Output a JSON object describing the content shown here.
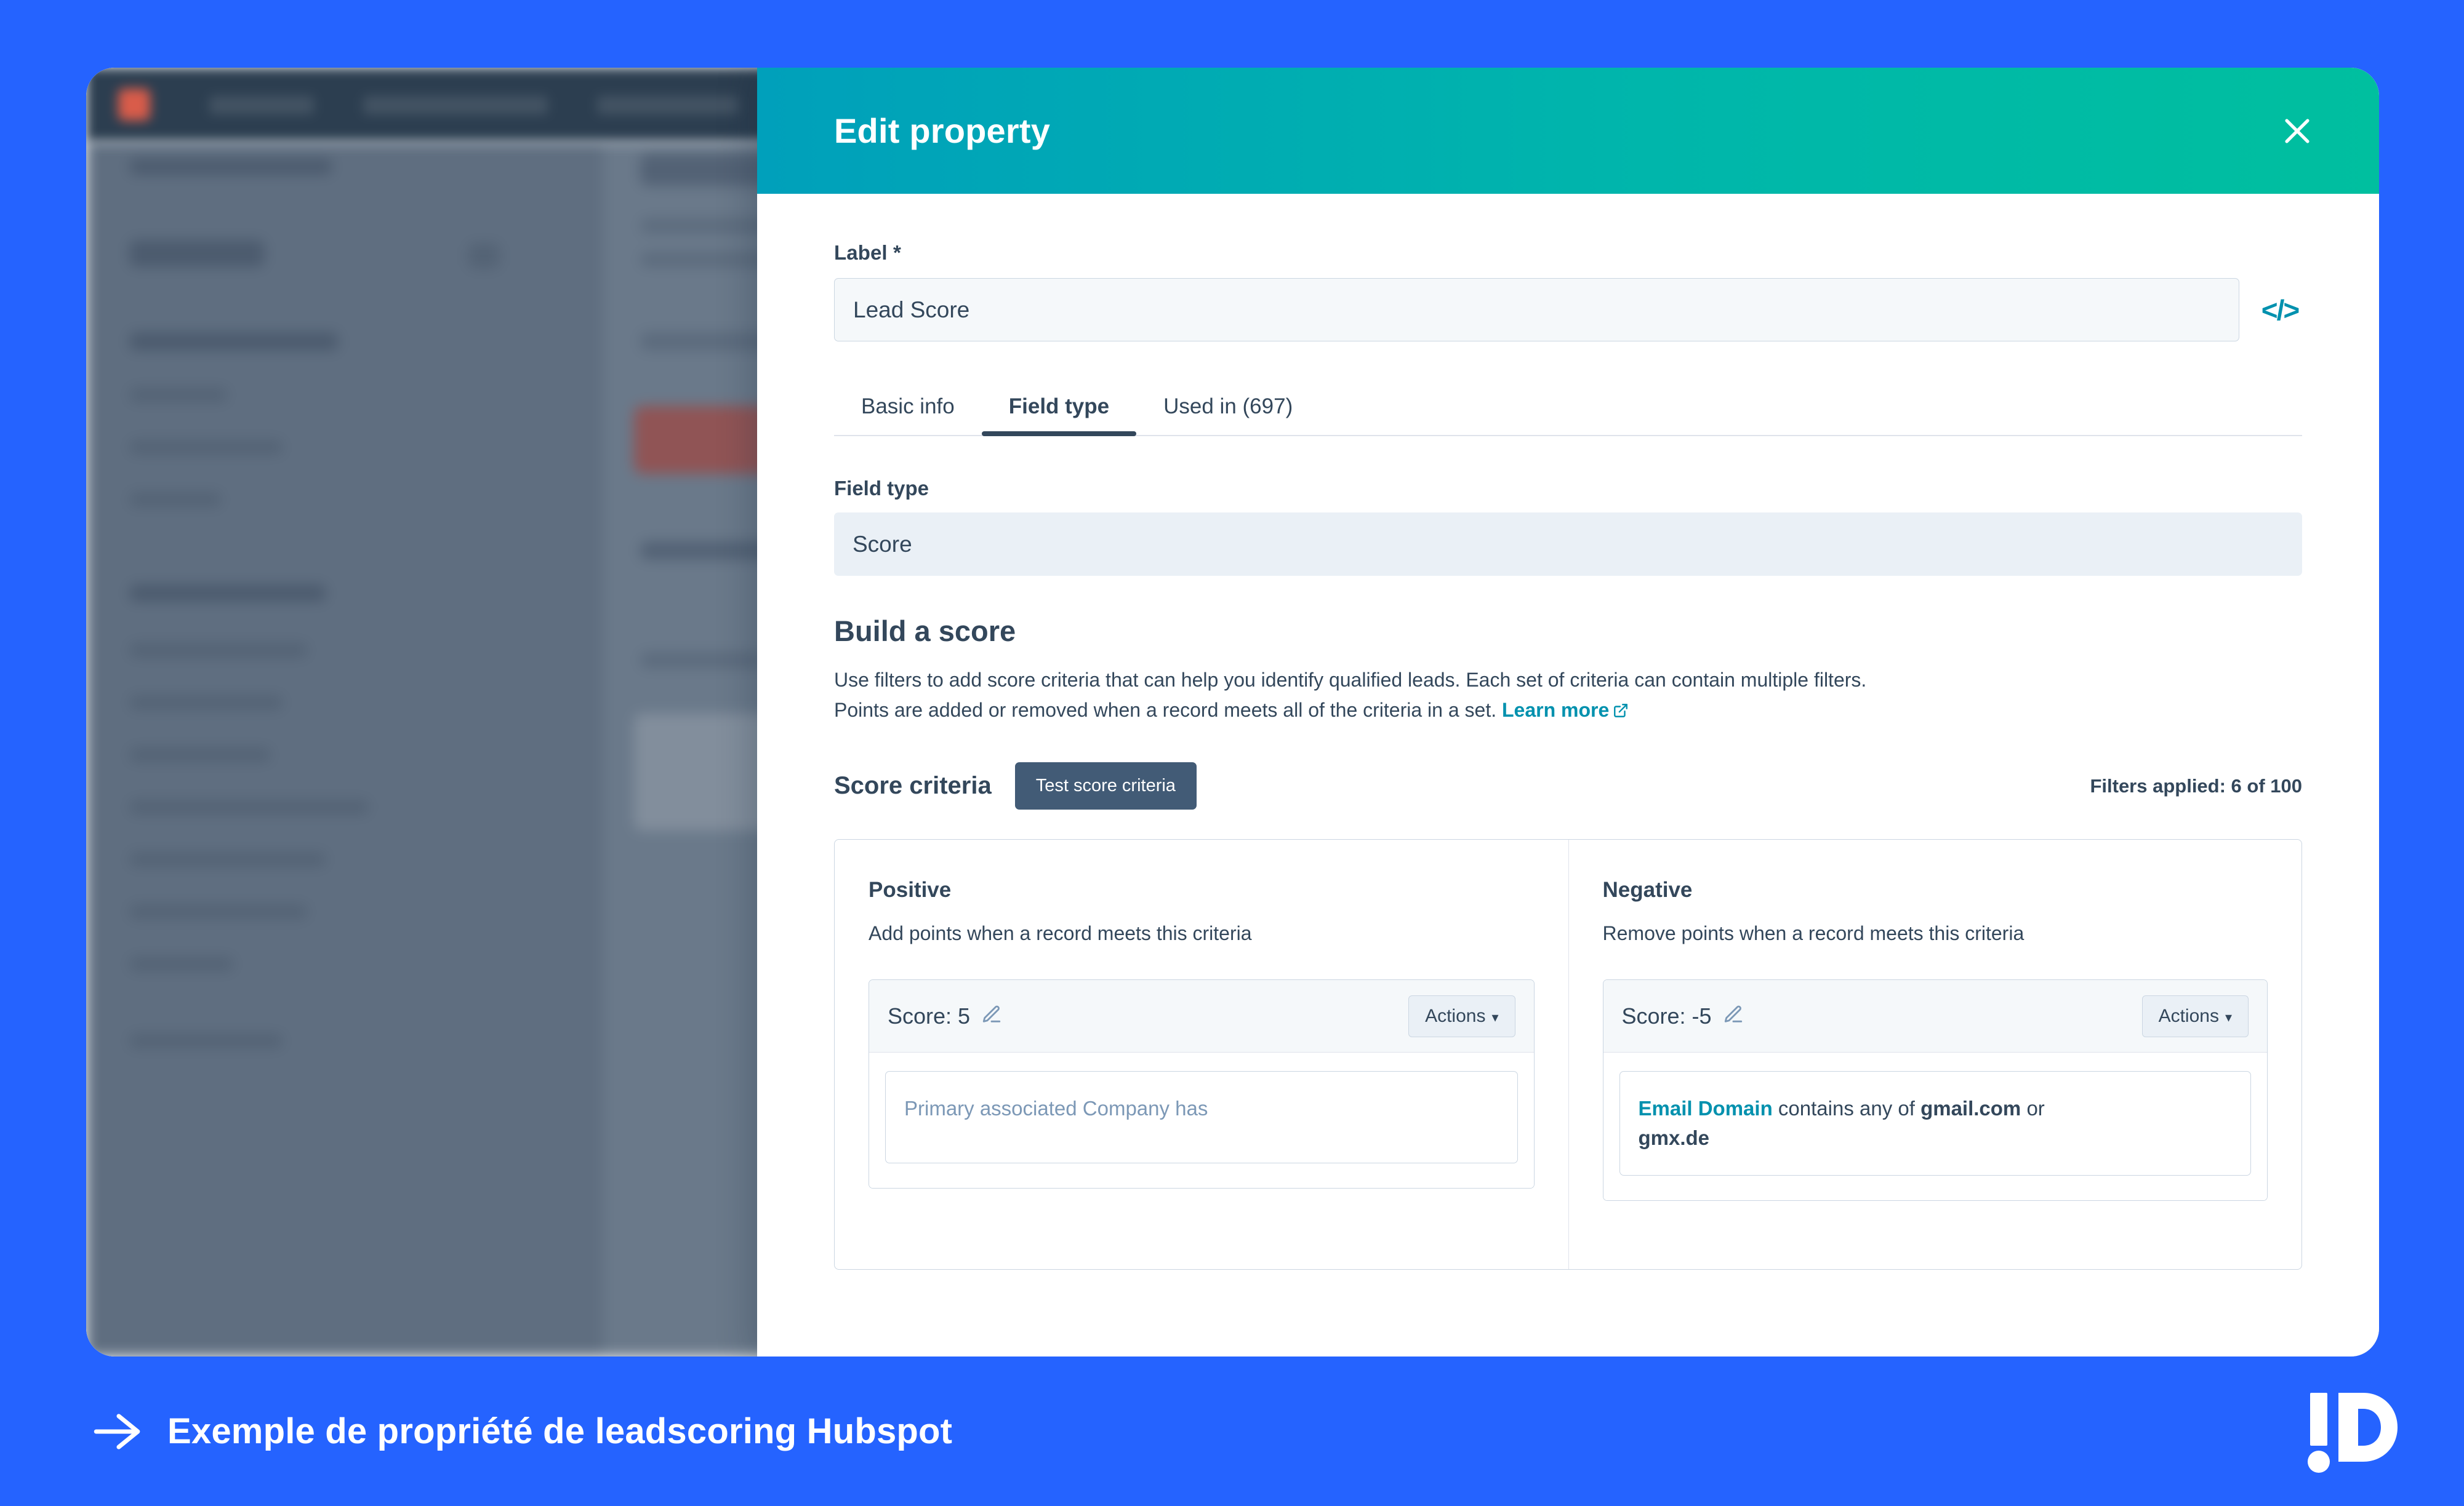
{
  "modal": {
    "title": "Edit property",
    "close_icon": "close-icon",
    "label_field": {
      "label": "Label *",
      "value": "Lead Score",
      "code_icon": "</>"
    },
    "tabs": [
      {
        "label": "Basic info",
        "active": false
      },
      {
        "label": "Field type",
        "active": true
      },
      {
        "label": "Used in (697)",
        "active": false
      }
    ],
    "field_type": {
      "label": "Field type",
      "value": "Score"
    },
    "build_a_score": {
      "title": "Build a score",
      "description_line1": "Use filters to add score criteria that can help you identify qualified leads. Each set of criteria can contain multiple filters.",
      "description_line2": "Points are added or removed when a record meets all of the criteria in a set.",
      "learn_more": "Learn more"
    },
    "score_criteria": {
      "title": "Score criteria",
      "test_button": "Test score criteria",
      "filters_applied": "Filters applied: 6 of 100",
      "columns": [
        {
          "title": "Positive",
          "subtitle": "Add points when a record meets this criteria",
          "score_label": "Score: 5",
          "actions_label": "Actions",
          "filter_text": "Primary associated Company has",
          "filter_is_placeholder": true
        },
        {
          "title": "Negative",
          "subtitle": "Remove points when a record meets this criteria",
          "score_label": "Score: -5",
          "actions_label": "Actions",
          "filter_property": "Email Domain",
          "filter_mid": " contains any of ",
          "filter_value": "gmail.com",
          "filter_tail": " or",
          "filter_line2": "gmx.de",
          "filter_is_placeholder": false
        }
      ]
    }
  },
  "caption": {
    "arrow_icon": "arrow-right-icon",
    "text": "Exemple de propriété de leadscoring Hubspot",
    "logo": "!D"
  },
  "colors": {
    "brand_blue": "#2563ff",
    "header_gradient_start": "#00a0bb",
    "header_gradient_end": "#00bf9f",
    "accent_teal": "#0091ae",
    "text_dark": "#33475b",
    "button_dark": "#425b76"
  }
}
